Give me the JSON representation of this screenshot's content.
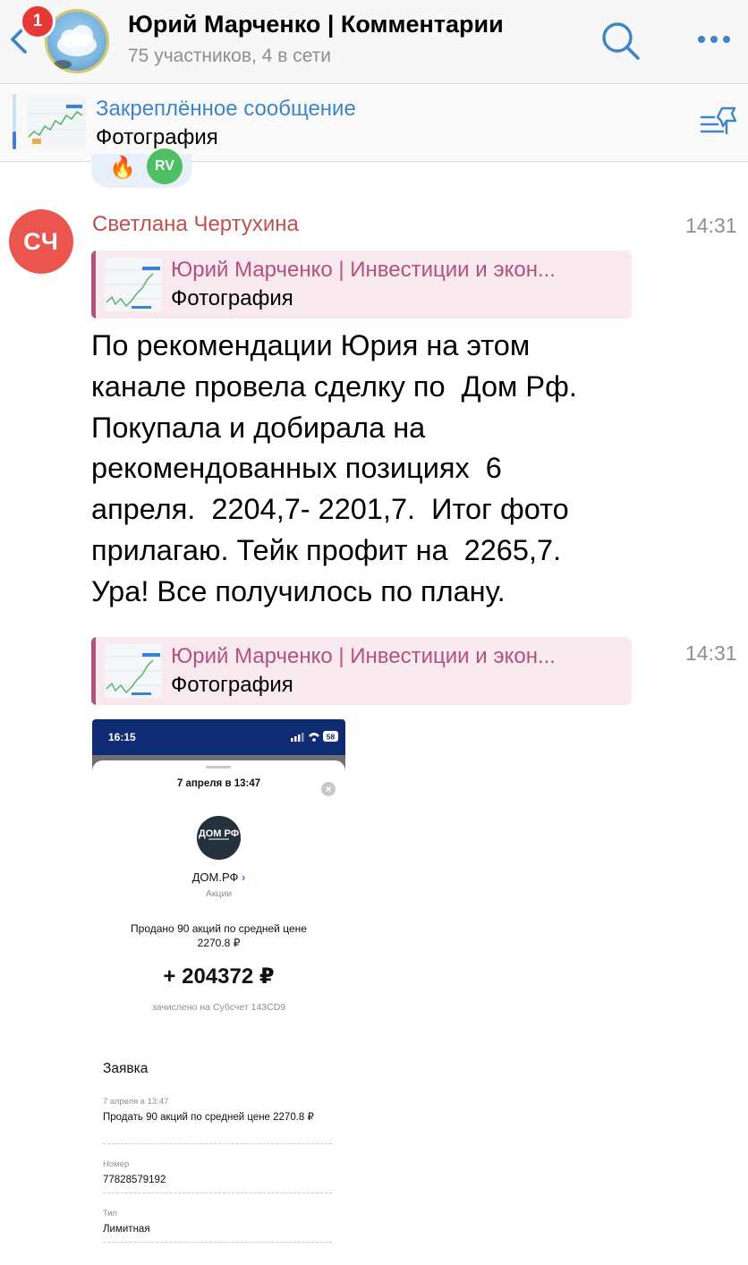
{
  "header": {
    "badge_count": "1",
    "title": "Юрий Марченко | Комментарии",
    "subtitle": "75 участников, 4 в сети",
    "icons": [
      "chevron-left-icon",
      "search-icon",
      "more-icon"
    ],
    "accent": "#3d85c6"
  },
  "pinned": {
    "label": "Закреплённое сообщение",
    "text": "Фотография",
    "icon": "pinned-list-icon"
  },
  "reactions": {
    "fire": "🔥",
    "rv_initials": "RV"
  },
  "messages": {
    "avatar_initials": "СЧ",
    "sender": "Светлана Чертухина",
    "first": {
      "time": "14:31",
      "forward_title": "Юрий Марченко | Инвестиции и экон...",
      "forward_text": "Фотография",
      "text_lines": [
        "По рекомендации Юрия на этом",
        "канале провела сделку по  Дом Рф.",
        "Покупала и добирала на",
        "рекомендованных позициях  6",
        "апреля.  2204,7- 2201,7.  Итог фото",
        "прилагаю. Тейк профит на  2265,7.",
        "Ура! Все получилось по плану."
      ]
    },
    "second": {
      "time": "14:31",
      "forward_title": "Юрий Марченко | Инвестиции и экон...",
      "forward_text": "Фотография"
    }
  },
  "photo": {
    "status_time": "16:15",
    "battery": "58",
    "date": "7 апреля в 13:47",
    "logo_text": "ДОМ РФ",
    "company": "ДОМ.РФ",
    "company_chevron": "›",
    "kind": "Акции",
    "description": "Продано 90 акций по средней цене 2270.8 ₽",
    "amount": "+ 204372 ₽",
    "account": "зачислено на Субсчет 143CD9",
    "order_title": "Заявка",
    "rows": [
      {
        "label": "7 апреля в 13:47",
        "value": "Продать 90 акций по средней цене 2270.8 ₽"
      },
      {
        "label": "Номер",
        "value": "77828579192"
      },
      {
        "label": "Тип",
        "value": "Лимитная"
      }
    ]
  }
}
